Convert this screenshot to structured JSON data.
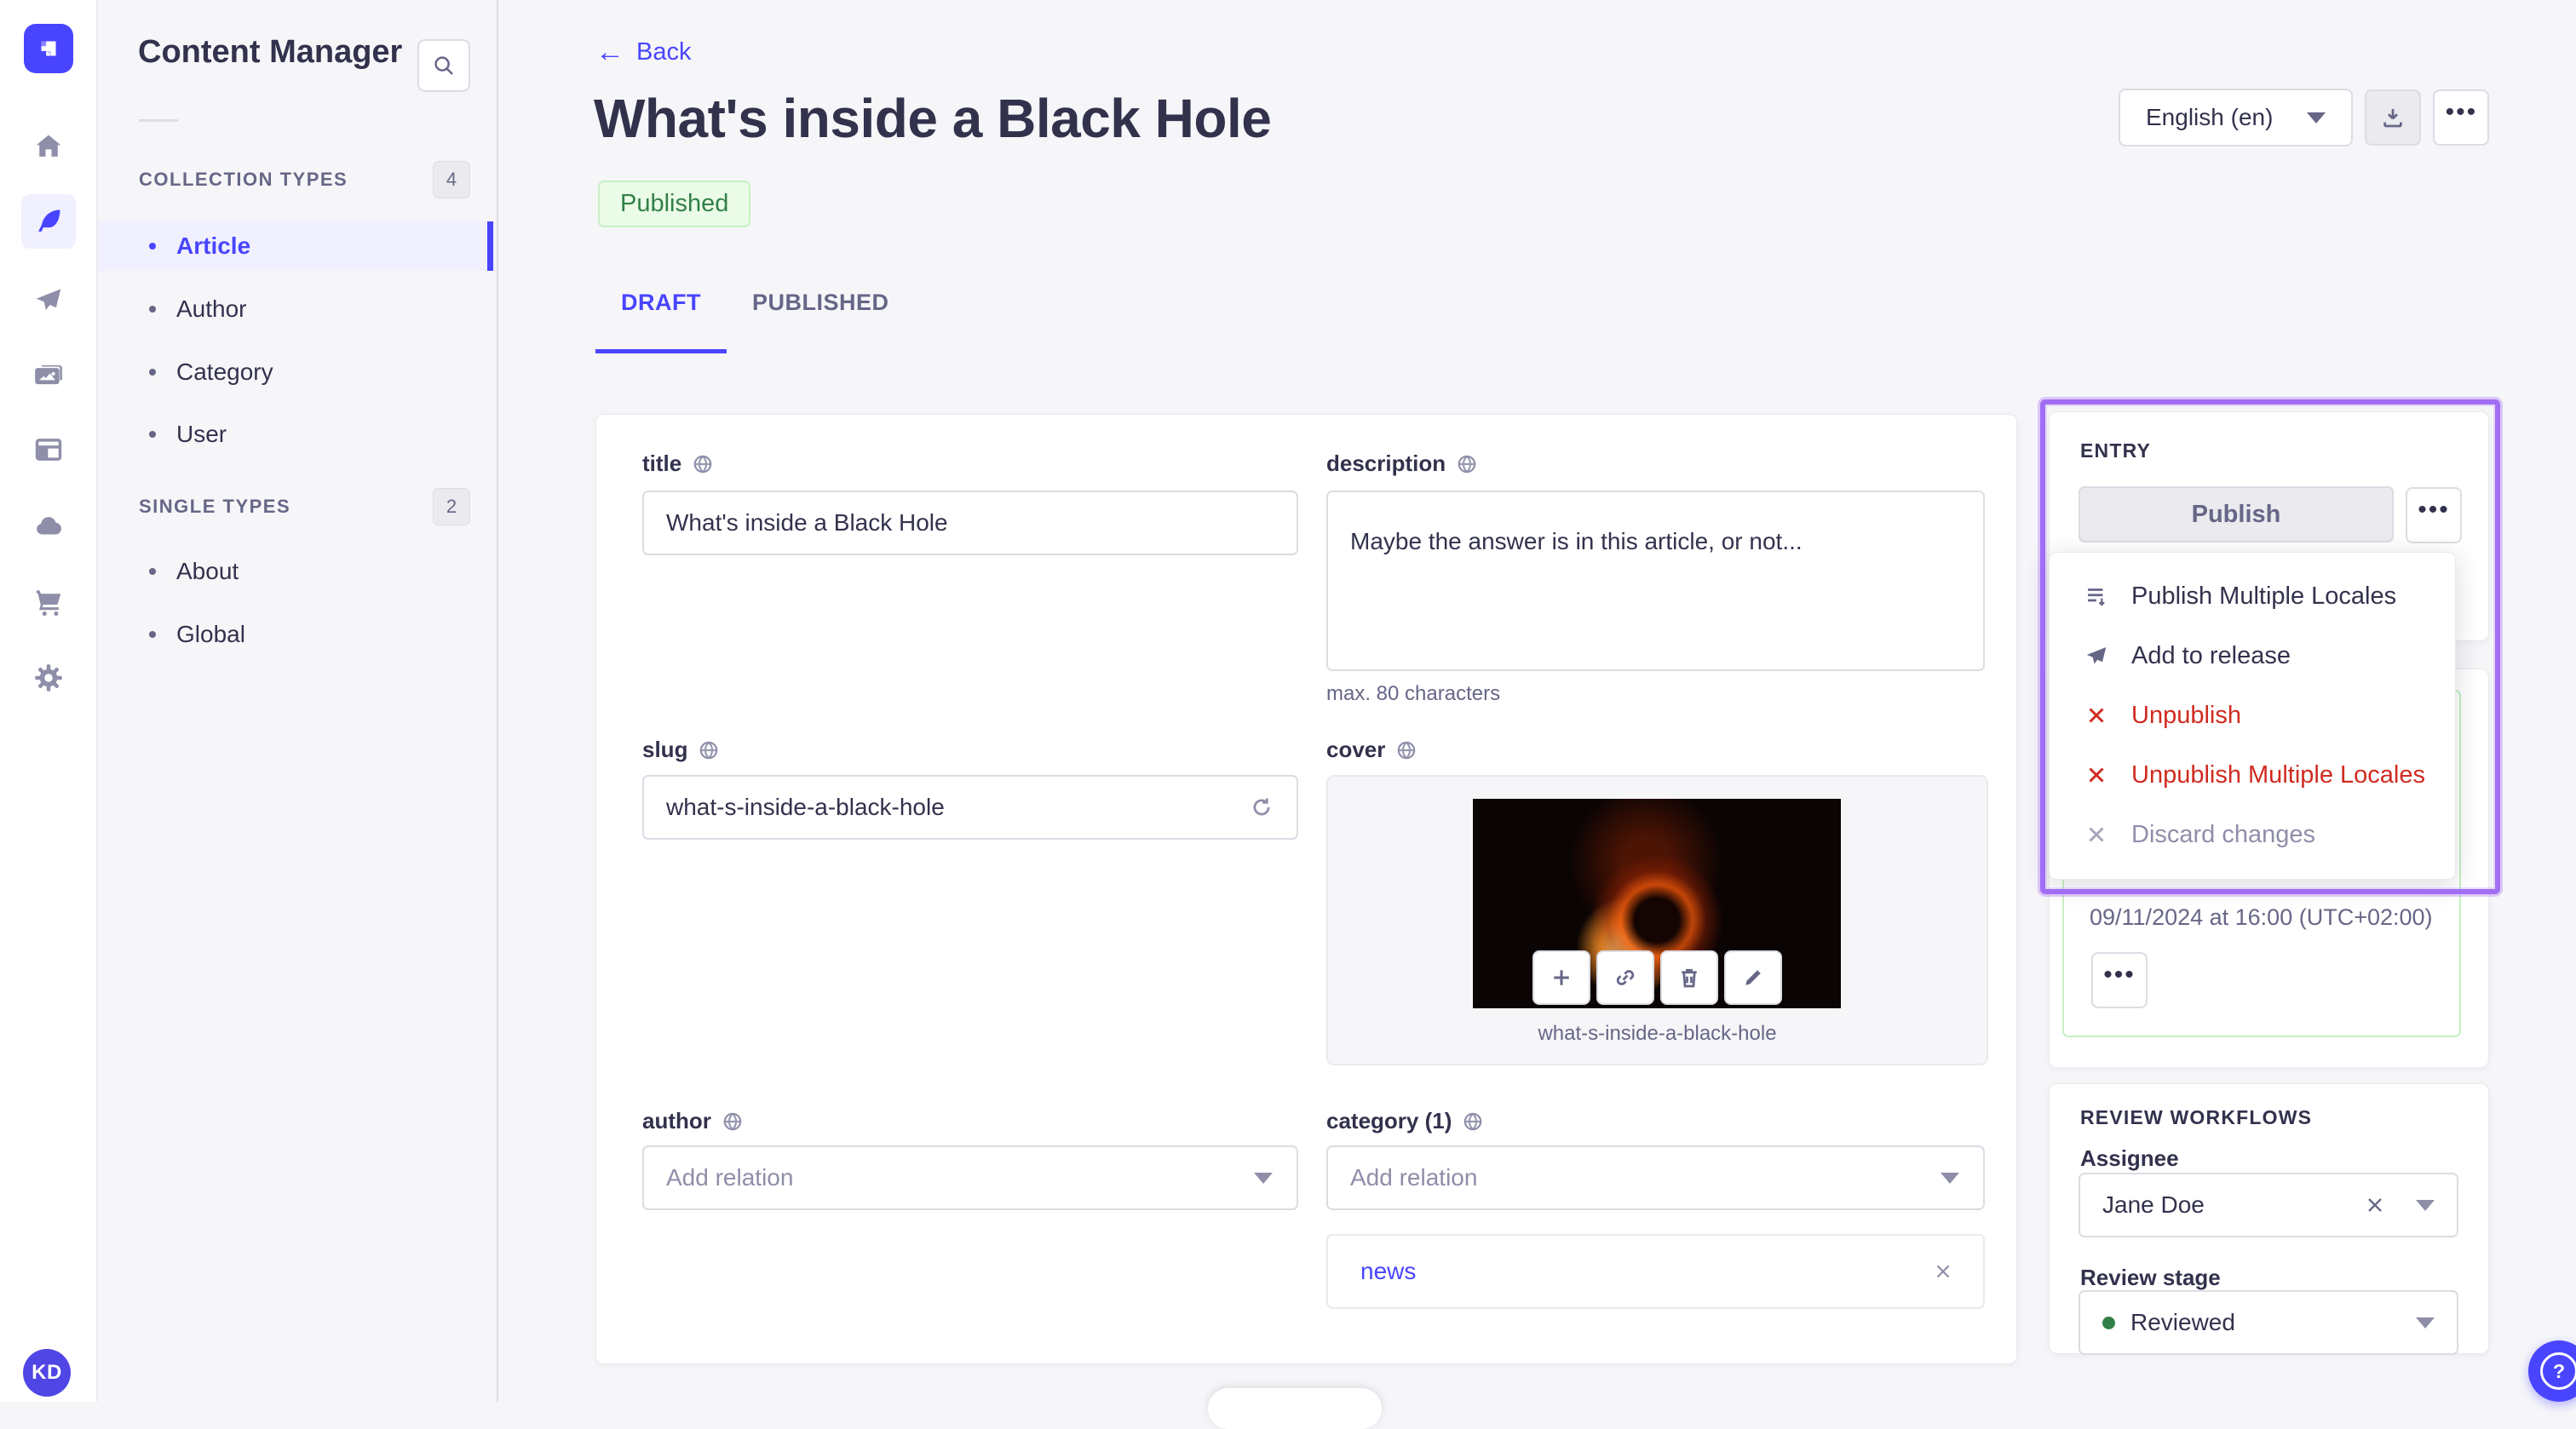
{
  "colors": {
    "accent": "#4945ff",
    "accent_bg": "#f0f0ff",
    "success_text": "#328048",
    "success_bg": "#eafbe7",
    "success_border": "#c6f0c2",
    "danger": "#d02b20",
    "highlight_border": "#a16ef4",
    "text_dark": "#32324d",
    "text_grey": "#666687"
  },
  "nav_rail": {
    "logo_icon": "strapi-logo",
    "items": [
      {
        "icon": "home-icon"
      },
      {
        "icon": "feather-content-icon",
        "active": true
      },
      {
        "icon": "paper-plane-icon"
      },
      {
        "icon": "media-images-icon"
      },
      {
        "icon": "layout-icon"
      },
      {
        "icon": "cloud-icon"
      },
      {
        "icon": "cart-icon"
      },
      {
        "icon": "gear-icon"
      }
    ],
    "avatar_initials": "KD"
  },
  "sidebar": {
    "title": "Content Manager",
    "search_icon": "search-icon",
    "sections": [
      {
        "label": "COLLECTION TYPES",
        "count": "4",
        "items": [
          {
            "label": "Article",
            "active": true
          },
          {
            "label": "Author"
          },
          {
            "label": "Category"
          },
          {
            "label": "User"
          }
        ]
      },
      {
        "label": "SINGLE TYPES",
        "count": "2",
        "items": [
          {
            "label": "About"
          },
          {
            "label": "Global"
          }
        ]
      }
    ]
  },
  "header": {
    "back_label": "Back",
    "back_arrow": "←",
    "title": "What's inside a Black Hole",
    "status_badge": "Published",
    "locale_select_value": "English (en)",
    "download_icon": "download-icon",
    "more_icon": "ellipsis-icon",
    "more_glyph": "•••"
  },
  "tabs": [
    {
      "label": "DRAFT",
      "active": true
    },
    {
      "label": "PUBLISHED"
    }
  ],
  "form": {
    "title_field": {
      "label": "title",
      "value": "What's inside a Black Hole"
    },
    "description_field": {
      "label": "description",
      "value": "Maybe the answer is in this article, or not...",
      "hint": "max. 80 characters"
    },
    "slug_field": {
      "label": "slug",
      "value": "what-s-inside-a-black-hole"
    },
    "cover_field": {
      "label": "cover",
      "caption": "what-s-inside-a-black-hole"
    },
    "author_field": {
      "label": "author",
      "placeholder": "Add relation"
    },
    "category_field": {
      "label": "category (1)",
      "placeholder": "Add relation",
      "relation": "news"
    }
  },
  "entry_panel": {
    "heading": "ENTRY",
    "publish_label": "Publish",
    "more_glyph": "•••",
    "menu": [
      {
        "label": "Publish Multiple Locales",
        "icon": "list-plus-icon",
        "variant": "default"
      },
      {
        "label": "Add to release",
        "icon": "paper-plane-icon",
        "variant": "default"
      },
      {
        "label": "Unpublish",
        "icon": "cross-icon",
        "variant": "danger"
      },
      {
        "label": "Unpublish Multiple Locales",
        "icon": "cross-icon",
        "variant": "danger"
      },
      {
        "label": "Discard changes",
        "icon": "cross-icon",
        "variant": "disabled"
      }
    ],
    "release_date": "09/11/2024 at 16:00 (UTC+02:00)",
    "release_more_glyph": "•••"
  },
  "review_panel": {
    "heading": "REVIEW WORKFLOWS",
    "assignee_label": "Assignee",
    "assignee_value": "Jane Doe",
    "stage_label": "Review stage",
    "stage_value": "Reviewed"
  },
  "help": {
    "glyph": "?"
  }
}
